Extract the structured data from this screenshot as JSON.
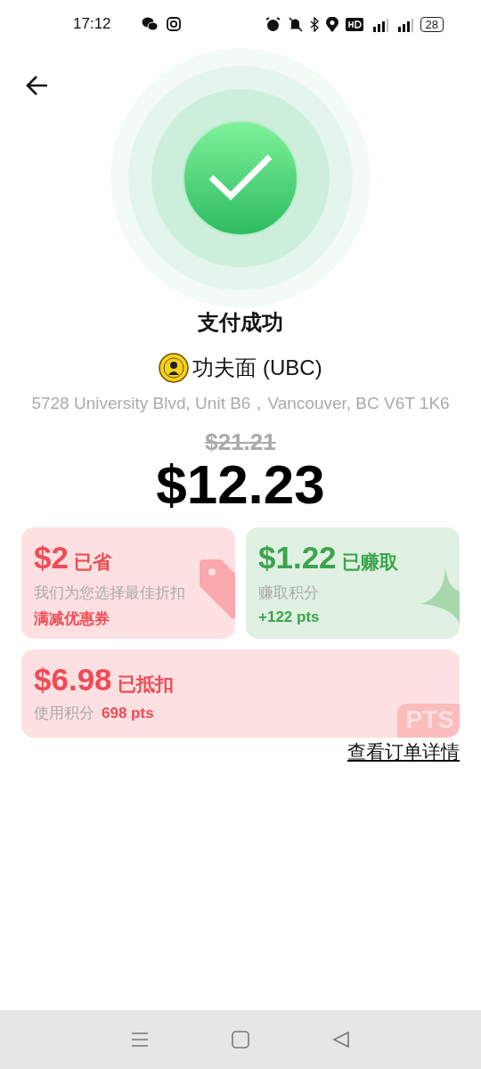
{
  "status_bar": {
    "time": "17:12",
    "battery": "28"
  },
  "title": "支付成功",
  "merchant": {
    "name": "功夫面 (UBC)",
    "address": "5728 University Blvd, Unit B6，Vancouver, BC V6T 1K6"
  },
  "price": {
    "original": "$21.21",
    "paid": "$12.23"
  },
  "cards": [
    {
      "kind": "saved",
      "amount": "$2",
      "label": "已省",
      "note": "我们为您选择最佳折扣",
      "detail": "满减优惠券"
    },
    {
      "kind": "earned",
      "amount": "$1.22",
      "label": "已赚取",
      "note": "赚取积分",
      "detail": "+122 pts"
    },
    {
      "kind": "deducted",
      "amount": "$6.98",
      "label": "已抵扣",
      "note": "使用积分",
      "detail": "698 pts",
      "badge": "PTS"
    }
  ],
  "order_link": "查看订单详情"
}
